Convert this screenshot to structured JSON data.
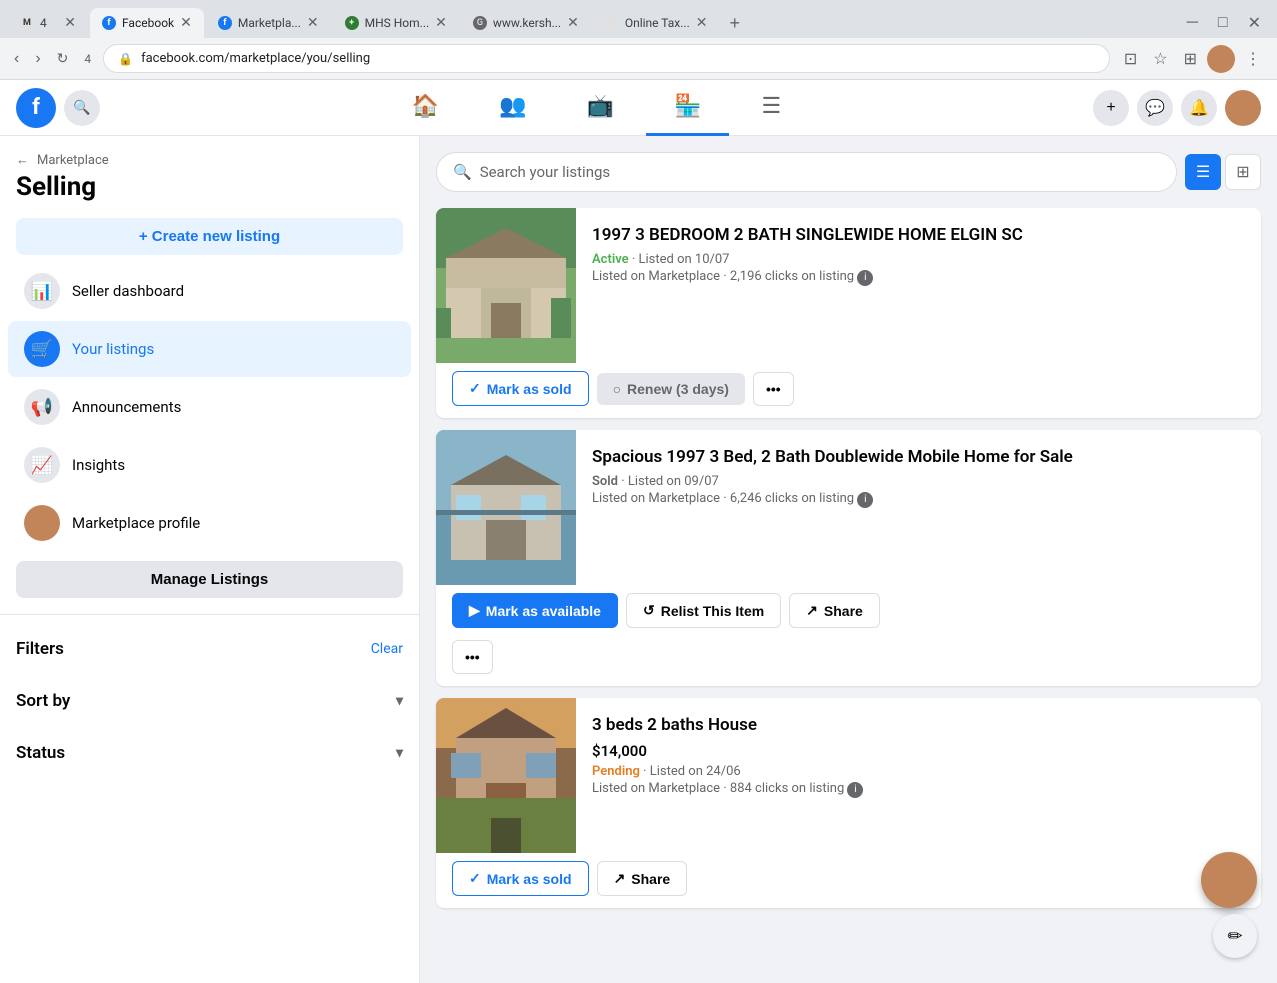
{
  "browser": {
    "tabs": [
      {
        "id": "tab1",
        "favicon_color": "#1877f2",
        "favicon_text": "M",
        "title": "4",
        "active": false
      },
      {
        "id": "tab2",
        "favicon_color": "#1877f2",
        "favicon_text": "f",
        "title": "Facebook",
        "active": true
      },
      {
        "id": "tab3",
        "favicon_color": "#1877f2",
        "favicon_text": "f",
        "title": "Marketpla...",
        "active": false
      },
      {
        "id": "tab4",
        "favicon_color": "#2e7d32",
        "favicon_text": "+",
        "title": "MHS Hom...",
        "active": false
      },
      {
        "id": "tab5",
        "favicon_color": "#65676b",
        "favicon_text": "G",
        "title": "www.kersh...",
        "active": false
      },
      {
        "id": "tab6",
        "favicon_color": "#e0e0e0",
        "favicon_text": " ",
        "title": "Online Tax...",
        "active": false
      }
    ],
    "address": "facebook.com/marketplace/you/selling",
    "tab_count": "4"
  },
  "fbNav": {
    "search_placeholder": "Search Facebook"
  },
  "sidebar": {
    "back_label": "Marketplace",
    "title": "Selling",
    "create_listing_label": "+ Create new listing",
    "nav_items": [
      {
        "id": "seller-dashboard",
        "icon": "📊",
        "label": "Seller dashboard",
        "icon_type": "gray"
      },
      {
        "id": "your-listings",
        "icon": "🛒",
        "label": "Your listings",
        "icon_type": "blue",
        "active": true
      },
      {
        "id": "announcements",
        "icon": "📢",
        "label": "Announcements",
        "icon_type": "gray"
      },
      {
        "id": "insights",
        "icon": "📊",
        "label": "Insights",
        "icon_type": "gray"
      },
      {
        "id": "marketplace-profile",
        "icon": "👤",
        "label": "Marketplace profile",
        "icon_type": "profile"
      }
    ],
    "manage_listings_label": "Manage Listings",
    "filters_label": "Filters",
    "clear_label": "Clear",
    "sort_by_label": "Sort by",
    "status_label": "Status"
  },
  "content": {
    "search_placeholder": "Search your listings",
    "view_list_label": "List view",
    "view_grid_label": "Grid view",
    "listings": [
      {
        "id": "listing1",
        "title": "1997 3 BEDROOM 2 BATH SINGLEWIDE HOME ELGIN SC",
        "status": "Active",
        "listed_date": "Listed on 10/07",
        "marketplace_info": "Listed on Marketplace · 2,196 clicks on listing",
        "actions": [
          "mark-as-sold",
          "renew",
          "more"
        ],
        "mark_as_sold_label": "Mark as sold",
        "renew_label": "Renew (3 days)",
        "more_label": "...",
        "img_type": "house1"
      },
      {
        "id": "listing2",
        "title": "Spacious 1997 3 Bed, 2 Bath Doublewide Mobile Home for Sale",
        "status": "Sold",
        "listed_date": "Listed on 09/07",
        "marketplace_info": "Listed on Marketplace · 6,246 clicks on listing",
        "actions": [
          "mark-as-available",
          "relist",
          "share",
          "more"
        ],
        "mark_as_available_label": "Mark as available",
        "relist_label": "Relist This Item",
        "share_label": "Share",
        "more_label": "...",
        "img_type": "house2"
      },
      {
        "id": "listing3",
        "title": "3 beds 2 baths House",
        "price": "$14,000",
        "status": "Pending",
        "listed_date": "Listed on 24/06",
        "marketplace_info": "Listed on Marketplace · 884 clicks on listing",
        "actions": [
          "mark-as-sold",
          "share"
        ],
        "mark_as_sold_label": "Mark as sold",
        "share_label": "Share",
        "img_type": "house3"
      }
    ]
  }
}
